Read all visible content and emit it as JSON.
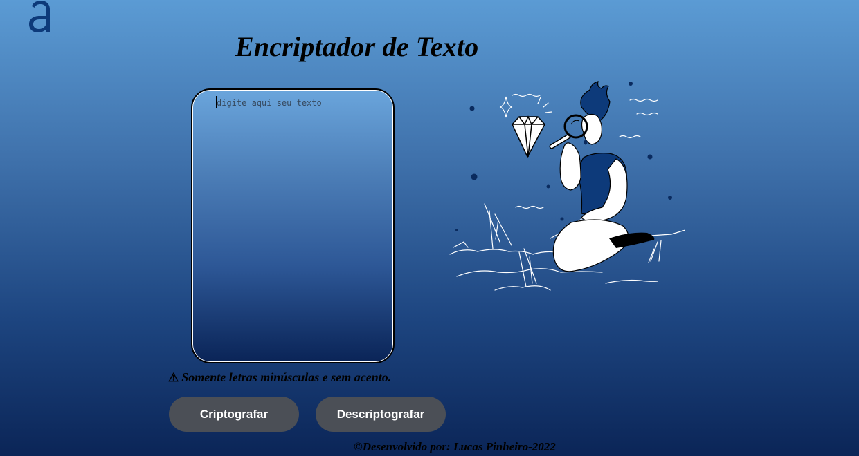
{
  "app": {
    "logo_icon": "alura-a-logo-icon",
    "title": "Encriptador de Texto"
  },
  "input": {
    "placeholder": "digite aqui seu texto",
    "value": ""
  },
  "warning": {
    "icon": "warning-triangle-icon",
    "symbol": "⚠",
    "text": "Somente letras minúsculas e sem acento."
  },
  "buttons": {
    "encrypt_label": "Criptografar",
    "decrypt_label": "Descriptografar"
  },
  "footer": {
    "text": "©Desenvolvido por: Lucas Pinheiro-2022"
  },
  "illustration": {
    "icon": "person-with-magnifier-and-diamond-illustration"
  },
  "colors": {
    "background_top": "#5b9bd4",
    "background_bottom": "#0b2557",
    "button_bg": "#4b4f56",
    "button_text": "#ffffff",
    "logo": "#0d3a7a"
  }
}
